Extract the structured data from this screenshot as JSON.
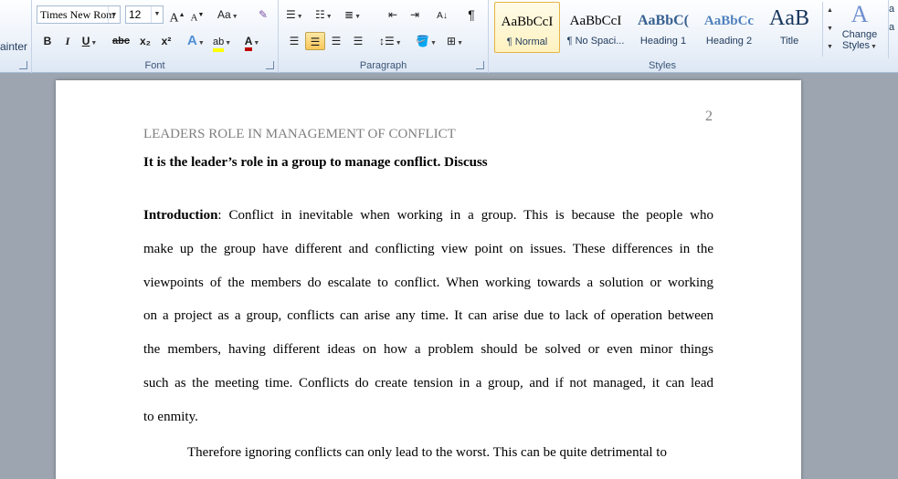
{
  "ribbon": {
    "clipboard": {
      "painter_label": "ainter"
    },
    "font": {
      "group_label": "Font",
      "font_name": "Times New Rom",
      "font_size": "12",
      "grow_label": "A",
      "shrink_label": "A",
      "change_case_label": "Aa",
      "bold_label": "B",
      "italic_label": "I",
      "underline_label": "U",
      "strikethrough_label": "abc",
      "subscript_label": "x₂",
      "superscript_label": "x²",
      "text_effects_label": "A",
      "font_color_label": "A"
    },
    "paragraph": {
      "group_label": "Paragraph",
      "pilcrow_label": "¶"
    },
    "styles": {
      "group_label": "Styles",
      "items": [
        {
          "sample": "AaBbCcI",
          "name": "¶ Normal"
        },
        {
          "sample": "AaBbCcI",
          "name": "¶ No Spaci..."
        },
        {
          "sample": "AaBbC(",
          "name": "Heading 1"
        },
        {
          "sample": "AaBbCc",
          "name": "Heading 2"
        },
        {
          "sample": "AaB",
          "name": "Title"
        }
      ],
      "change_styles_line1": "Change",
      "change_styles_line2": "Styles"
    }
  },
  "document": {
    "page_number": "2",
    "running_head": "LEADERS ROLE IN MANAGEMENT OF CONFLICT",
    "title": "It is the leader’s role in a group to manage conflict. Discuss",
    "intro_label": "Introduction",
    "intro_lines": [
      ": Conflict in inevitable when working in a group. This is because the people who",
      "make up the group have different and conflicting view point on issues.  These differences in the",
      "viewpoints of the members  do escalate to conflict. When working towards a solution  or working",
      "on a project as a group, conflicts can arise any time. It can arise  due to lack of operation between",
      "the members, having different ideas on how a problem should be solved or even minor things",
      "such as the meeting time.  Conflicts do create tension in a group, and if not managed, it can lead",
      "to enmity."
    ],
    "second_para_start": "Therefore ignoring conflicts can only lead to the worst. This  can be quite detrimental to"
  },
  "colors": {
    "ribbon_bg": "#eef3fa",
    "doc_bg": "#9da5b0",
    "selected_style": "#fff2c0",
    "font_color_bar": "#c00000",
    "highlight_bar": "#ffff00"
  }
}
